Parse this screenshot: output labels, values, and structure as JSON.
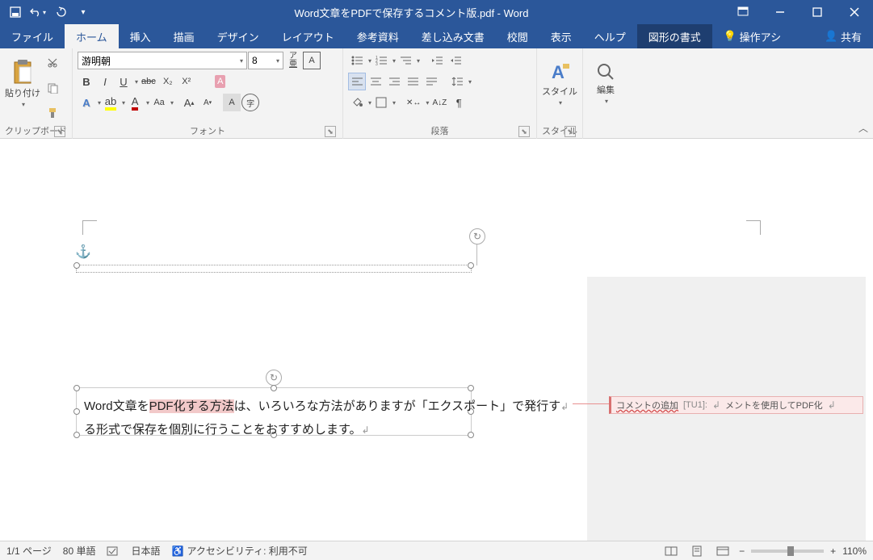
{
  "title": "Word文章をPDFで保存するコメント版.pdf  -  Word",
  "tabs": {
    "file": "ファイル",
    "home": "ホーム",
    "insert": "挿入",
    "draw": "描画",
    "design": "デザイン",
    "layout": "レイアウト",
    "references": "参考資料",
    "mailings": "差し込み文書",
    "review": "校閲",
    "view": "表示",
    "help": "ヘルプ",
    "shapeformat": "図形の書式",
    "tellme": "操作アシ",
    "share": "共有"
  },
  "ribbon": {
    "clipboard": {
      "paste": "貼り付け",
      "label": "クリップボード"
    },
    "font": {
      "label": "フォント",
      "name": "游明朝",
      "size": "8",
      "bold": "B",
      "italic": "I",
      "underline": "U",
      "strike": "abc",
      "sub": "X₂",
      "sup": "X²"
    },
    "paragraph": {
      "label": "段落"
    },
    "styles": {
      "big": "スタイル",
      "label": "スタイル"
    },
    "editing": {
      "big": "編集"
    }
  },
  "document": {
    "line1_pre": "Word文章を",
    "line1_hi": "PDF化する方法",
    "line1_post": "は、いろいろな方法がありますが「エクスポート」で発行す",
    "line2": "る形式で保存を個別に行うことをおすすめします。"
  },
  "comment": {
    "add": "コメントの追加",
    "tag": "[TU1]:",
    "text": "メントを使用してPDF化"
  },
  "statusbar": {
    "page": "1/1 ページ",
    "words": "80 単語",
    "lang": "日本語",
    "access": "アクセシビリティ: 利用不可",
    "zoom": "110%"
  }
}
